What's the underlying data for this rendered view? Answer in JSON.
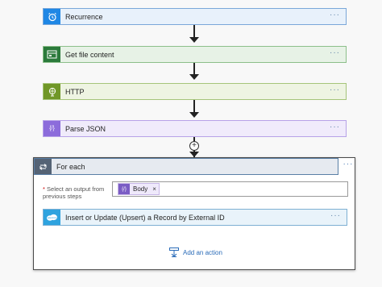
{
  "steps": [
    {
      "label": "Recurrence",
      "icon": "alarm-clock-icon",
      "color": "#1f87e5"
    },
    {
      "label": "Get file content",
      "icon": "ftp-icon",
      "color": "#2b7a3b"
    },
    {
      "label": "HTTP",
      "icon": "globe-icon",
      "color": "#709727"
    },
    {
      "label": "Parse JSON",
      "icon": "data-operation-icon",
      "color": "#8c6cdb"
    }
  ],
  "more_glyph": "···",
  "add_step_glyph": "+",
  "foreach": {
    "title": "For each",
    "select_label": "Select an output from previous steps",
    "required_mark": "*",
    "token_label": "Body",
    "token_remove": "×",
    "token_icon_text": "{/}",
    "inner_action": "Insert or Update (Upsert) a Record by External ID",
    "inner_icon_text": "salesforce",
    "add_action": "Add an action"
  }
}
